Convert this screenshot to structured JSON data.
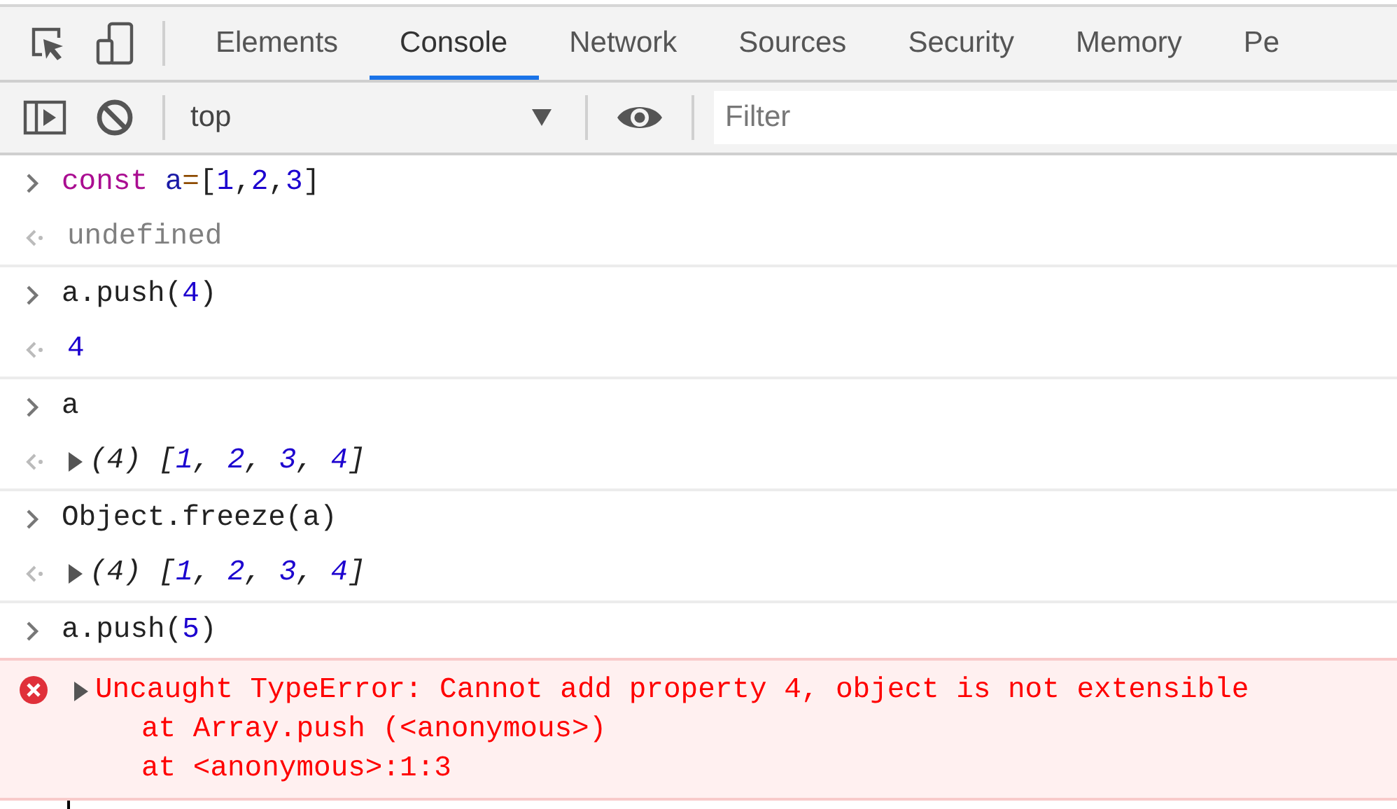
{
  "tabs": [
    {
      "label": "Elements",
      "selected": false
    },
    {
      "label": "Console",
      "selected": true
    },
    {
      "label": "Network",
      "selected": false
    },
    {
      "label": "Sources",
      "selected": false
    },
    {
      "label": "Security",
      "selected": false
    },
    {
      "label": "Memory",
      "selected": false
    },
    {
      "label": "Pe",
      "selected": false
    }
  ],
  "context": "top",
  "filter": {
    "placeholder": "Filter"
  },
  "entries": [
    {
      "input": [
        {
          "text": "const ",
          "kind": "keyword"
        },
        {
          "text": "a",
          "kind": "variable"
        },
        {
          "text": "=",
          "kind": "operator"
        },
        {
          "text": "[",
          "kind": "plain"
        },
        {
          "text": "1",
          "kind": "number"
        },
        {
          "text": ",",
          "kind": "plain"
        },
        {
          "text": "2",
          "kind": "number"
        },
        {
          "text": ",",
          "kind": "plain"
        },
        {
          "text": "3",
          "kind": "number"
        },
        {
          "text": "]",
          "kind": "plain"
        }
      ],
      "result": {
        "kind": "value",
        "tokens": [
          {
            "text": "undefined",
            "kind": "null"
          }
        ]
      }
    },
    {
      "input": [
        {
          "text": "a.push(",
          "kind": "plain"
        },
        {
          "text": "4",
          "kind": "number"
        },
        {
          "text": ")",
          "kind": "plain"
        }
      ],
      "result": {
        "kind": "value",
        "tokens": [
          {
            "text": "4",
            "kind": "number"
          }
        ]
      }
    },
    {
      "input": [
        {
          "text": "a",
          "kind": "plain"
        }
      ],
      "result": {
        "kind": "object",
        "expanded": false,
        "tokens": [
          {
            "text": "(4) [",
            "kind": "plain"
          },
          {
            "text": "1",
            "kind": "number"
          },
          {
            "text": ", ",
            "kind": "plain"
          },
          {
            "text": "2",
            "kind": "number"
          },
          {
            "text": ", ",
            "kind": "plain"
          },
          {
            "text": "3",
            "kind": "number"
          },
          {
            "text": ", ",
            "kind": "plain"
          },
          {
            "text": "4",
            "kind": "number"
          },
          {
            "text": "]",
            "kind": "plain"
          }
        ]
      }
    },
    {
      "input": [
        {
          "text": "Object.freeze(a)",
          "kind": "plain"
        }
      ],
      "result": {
        "kind": "object",
        "expanded": false,
        "tokens": [
          {
            "text": "(4) [",
            "kind": "plain"
          },
          {
            "text": "1",
            "kind": "number"
          },
          {
            "text": ", ",
            "kind": "plain"
          },
          {
            "text": "2",
            "kind": "number"
          },
          {
            "text": ", ",
            "kind": "plain"
          },
          {
            "text": "3",
            "kind": "number"
          },
          {
            "text": ", ",
            "kind": "plain"
          },
          {
            "text": "4",
            "kind": "number"
          },
          {
            "text": "]",
            "kind": "plain"
          }
        ]
      }
    },
    {
      "input": [
        {
          "text": "a.push(",
          "kind": "plain"
        },
        {
          "text": "5",
          "kind": "number"
        },
        {
          "text": ")",
          "kind": "plain"
        }
      ],
      "result": {
        "kind": "error",
        "expanded": false,
        "lines": [
          "Uncaught TypeError: Cannot add property 4, object is not extensible",
          "at Array.push (<anonymous>)",
          "at <anonymous>:1:3"
        ]
      }
    }
  ]
}
